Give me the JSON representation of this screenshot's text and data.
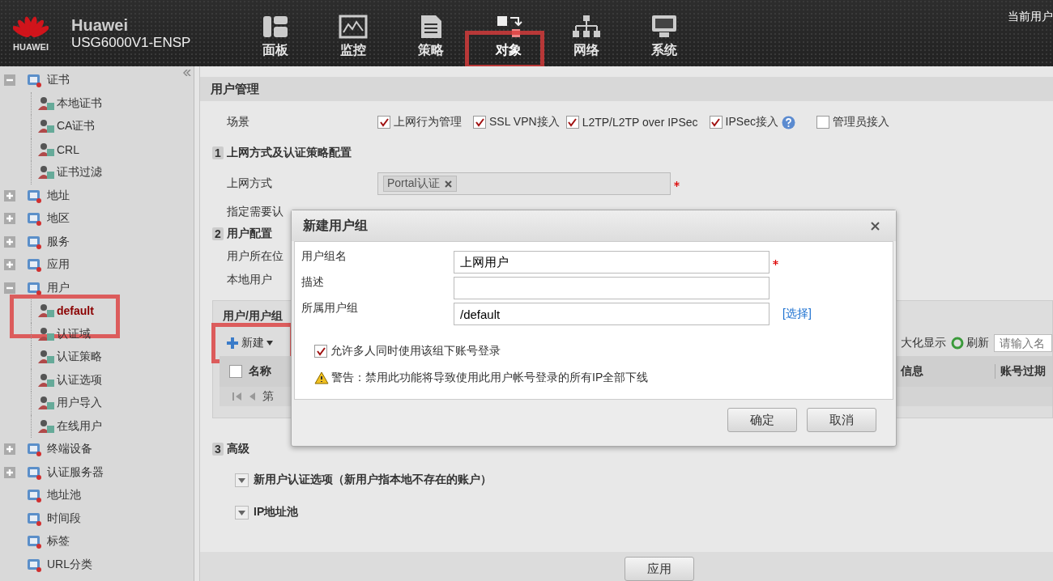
{
  "header": {
    "brand": "Huawei",
    "logo_text": "HUAWEI",
    "model": "USG6000V1-ENSP",
    "user_label": "当前用户",
    "nav": [
      {
        "label": "面板",
        "selected": false,
        "highlighted": false
      },
      {
        "label": "监控",
        "selected": false,
        "highlighted": false
      },
      {
        "label": "策略",
        "selected": false,
        "highlighted": false
      },
      {
        "label": "对象",
        "selected": true,
        "highlighted": true
      },
      {
        "label": "网络",
        "selected": false,
        "highlighted": false
      },
      {
        "label": "系统",
        "selected": false,
        "highlighted": false
      }
    ]
  },
  "sidebar": {
    "tree": [
      {
        "label": "证书",
        "expanded": true,
        "selected": false,
        "highlighted": false,
        "children": [
          {
            "label": "本地证书",
            "selected": false,
            "highlighted": false
          },
          {
            "label": "CA证书",
            "selected": false,
            "highlighted": false
          },
          {
            "label": "CRL",
            "selected": false,
            "highlighted": false
          },
          {
            "label": "证书过滤",
            "selected": false,
            "highlighted": false
          }
        ]
      },
      {
        "label": "地址",
        "expanded": false,
        "selected": false,
        "highlighted": false
      },
      {
        "label": "地区",
        "expanded": false,
        "selected": false,
        "highlighted": false
      },
      {
        "label": "服务",
        "expanded": false,
        "selected": false,
        "highlighted": false
      },
      {
        "label": "应用",
        "expanded": false,
        "selected": false,
        "highlighted": false
      },
      {
        "label": "用户",
        "expanded": true,
        "selected": false,
        "highlighted": false,
        "children": [
          {
            "label": "default",
            "selected": true,
            "highlighted": true
          },
          {
            "label": "认证域",
            "selected": false,
            "highlighted": false
          },
          {
            "label": "认证策略",
            "selected": false,
            "highlighted": false
          },
          {
            "label": "认证选项",
            "selected": false,
            "highlighted": false
          },
          {
            "label": "用户导入",
            "selected": false,
            "highlighted": false
          },
          {
            "label": "在线用户",
            "selected": false,
            "highlighted": false
          }
        ]
      },
      {
        "label": "终端设备",
        "expanded": false,
        "selected": false,
        "highlighted": false
      },
      {
        "label": "认证服务器",
        "expanded": false,
        "selected": false,
        "highlighted": false
      },
      {
        "label": "地址池",
        "selected": false,
        "highlighted": false
      },
      {
        "label": "时间段",
        "selected": false,
        "highlighted": false
      },
      {
        "label": "标签",
        "selected": false,
        "highlighted": false
      },
      {
        "label": "URL分类",
        "selected": false,
        "highlighted": false
      }
    ]
  },
  "main": {
    "page_title": "用户管理",
    "scenario": {
      "label": "场景",
      "options": [
        {
          "label": "上网行为管理",
          "checked": true,
          "help": false
        },
        {
          "label": "SSL VPN接入",
          "checked": true,
          "help": false
        },
        {
          "label": "L2TP/L2TP over IPSec",
          "checked": true,
          "help": false
        },
        {
          "label": "IPSec接入",
          "checked": true,
          "help": true
        },
        {
          "label": "管理员接入",
          "checked": false,
          "help": false
        }
      ]
    },
    "section_1": {
      "number": "1",
      "title": "上网方式及认证策略配置",
      "access_label": "上网方式",
      "access_tags": [
        "Portal认证"
      ],
      "access_required": true,
      "row_label": "指定需要认"
    },
    "section_2": {
      "number": "2",
      "title": "用户配置",
      "row_labels": [
        "用户所在位",
        "本地用户"
      ]
    },
    "user_panel": {
      "title": "用户/用户组",
      "new_button": {
        "label": "新建",
        "highlighted": true
      },
      "maximize_label": "大化显示",
      "refresh_label": "刷新",
      "search_placeholder": "请输入名",
      "header_checked": false,
      "columns": [
        "名称",
        "信息",
        "账号过期"
      ],
      "pager_text": "第"
    },
    "section_3": {
      "number": "3",
      "title": "高级",
      "collapsibles": [
        "新用户认证选项（新用户指本地不存在的账户）",
        "IP地址池"
      ]
    },
    "apply_button": "应用"
  },
  "dialog": {
    "title": "新建用户组",
    "fields": [
      {
        "label": "用户组名",
        "value": "上网用户",
        "required": true
      },
      {
        "label": "描述",
        "required": false
      },
      {
        "label": "所属用户组",
        "value": "/default",
        "required": false,
        "link": "[选择]"
      }
    ],
    "allow_multi": {
      "label": "允许多人同时使用该组下账号登录",
      "checked": true
    },
    "warning": "警告：禁用此功能将导致使用此用户帐号登录的所有IP全部下线",
    "buttons": [
      "确定",
      "取消"
    ]
  }
}
